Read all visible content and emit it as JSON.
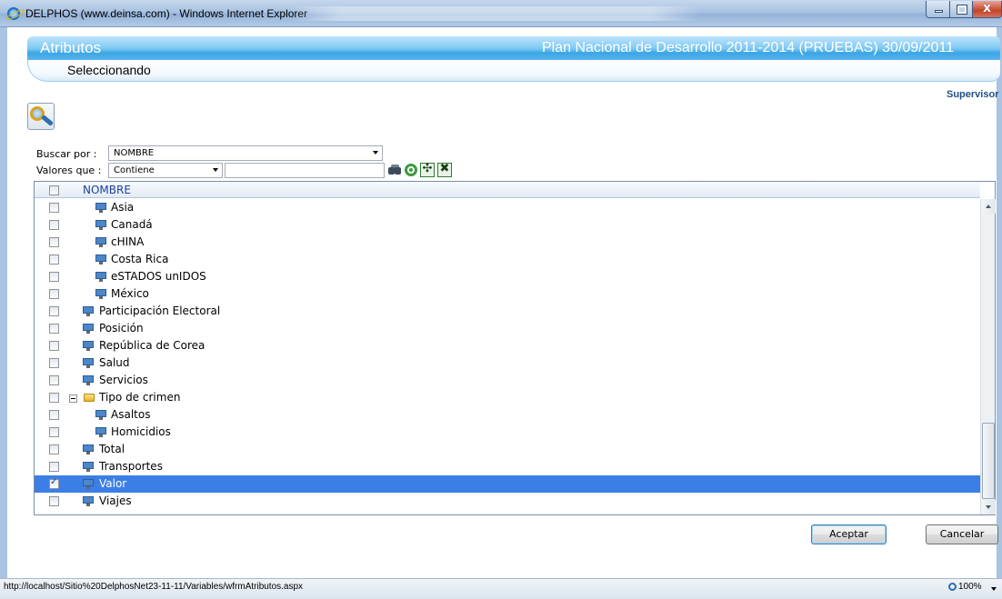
{
  "window": {
    "title": "DELPHOS (www.deinsa.com) - Windows Internet Explorer"
  },
  "header": {
    "app_title": "Atributos",
    "plan_title": "Plan Nacional de Desarrollo 2011-2014 (PRUEBAS) 30/09/2011",
    "subtitle": "Seleccionando",
    "user_role": "Supervisor"
  },
  "filters": {
    "buscar_label": "Buscar por :",
    "buscar_value": "NOMBRE",
    "valores_label": "Valores que :",
    "valores_value": "Contiene",
    "valor_input": ""
  },
  "grid": {
    "column_header": "NOMBRE",
    "rows": [
      {
        "label": "Asia",
        "level": 2,
        "checked": false
      },
      {
        "label": "Canadá",
        "level": 2,
        "checked": false
      },
      {
        "label": "cHINA",
        "level": 2,
        "checked": false
      },
      {
        "label": "Costa Rica",
        "level": 2,
        "checked": false
      },
      {
        "label": "eSTADOS unIDOS",
        "level": 2,
        "checked": false
      },
      {
        "label": "México",
        "level": 2,
        "checked": false
      },
      {
        "label": "Participación Electoral",
        "level": 1,
        "checked": false
      },
      {
        "label": "Posición",
        "level": 1,
        "checked": false
      },
      {
        "label": "República de Corea",
        "level": 1,
        "checked": false
      },
      {
        "label": "Salud",
        "level": 1,
        "checked": false
      },
      {
        "label": "Servicios",
        "level": 1,
        "checked": false
      },
      {
        "label": "Tipo de crimen",
        "level": 1,
        "checked": false,
        "folder": true,
        "expanded": true
      },
      {
        "label": "Asaltos",
        "level": 2,
        "checked": false
      },
      {
        "label": "Homicidios",
        "level": 2,
        "checked": false
      },
      {
        "label": "Total",
        "level": 1,
        "checked": false
      },
      {
        "label": "Transportes",
        "level": 1,
        "checked": false
      },
      {
        "label": "Valor",
        "level": 1,
        "checked": true,
        "selected": true
      },
      {
        "label": "Viajes",
        "level": 1,
        "checked": false
      }
    ]
  },
  "buttons": {
    "accept_label": "Aceptar",
    "cancel_label": "Cancelar"
  },
  "statusbar": {
    "url": "http://localhost/Sitio%20DelphosNet23-11-11/Variables/wfrmAtributos.aspx",
    "zoom": "100%"
  },
  "colors": {
    "header_blue": "#3aa6e6",
    "selected_row": "#3b7fe6",
    "grid_header_text": "#1d3f9e"
  }
}
